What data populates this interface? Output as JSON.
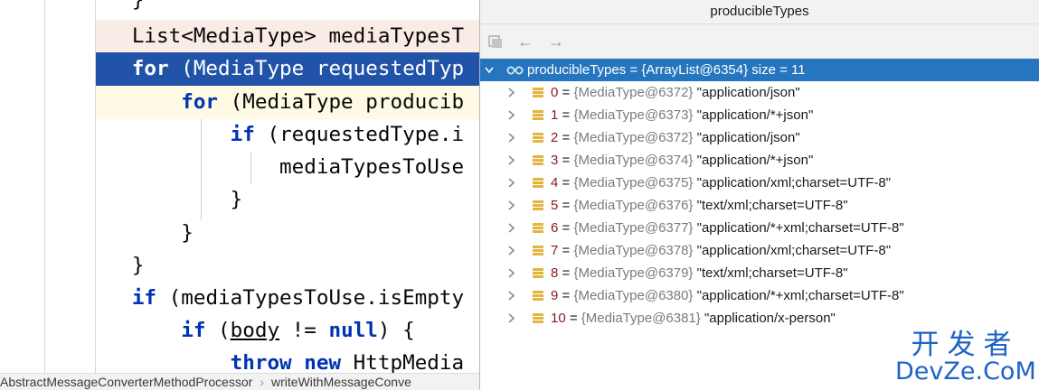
{
  "editor": {
    "lines": [
      {
        "indent": "   ",
        "tokens": [
          {
            "t": "}",
            "kw": false
          }
        ]
      },
      {
        "indent": "   ",
        "tokens": [
          {
            "t": "List<MediaType> mediaTypesT",
            "kw": false
          }
        ]
      },
      {
        "indent": "   ",
        "tokens": [
          {
            "t": "for",
            "kw": true
          },
          {
            "t": " (MediaType requestedTyp",
            "kw": false
          }
        ]
      },
      {
        "indent": "       ",
        "tokens": [
          {
            "t": "for",
            "kw": true
          },
          {
            "t": " (MediaType producib",
            "kw": false
          }
        ]
      },
      {
        "indent": "           ",
        "tokens": [
          {
            "t": "if",
            "kw": true
          },
          {
            "t": " (requestedType.i",
            "kw": false
          }
        ]
      },
      {
        "indent": "               ",
        "tokens": [
          {
            "t": "mediaTypesToUse",
            "kw": false
          }
        ]
      },
      {
        "indent": "           ",
        "tokens": [
          {
            "t": "}",
            "kw": false
          }
        ]
      },
      {
        "indent": "       ",
        "tokens": [
          {
            "t": "}",
            "kw": false
          }
        ]
      },
      {
        "indent": "   ",
        "tokens": [
          {
            "t": "}",
            "kw": false
          }
        ]
      },
      {
        "indent": "   ",
        "tokens": [
          {
            "t": "if",
            "kw": true
          },
          {
            "t": " (mediaTypesToUse.isEmpty",
            "kw": false
          }
        ]
      },
      {
        "indent": "       ",
        "tokens": [
          {
            "t": "if",
            "kw": true
          },
          {
            "t": " (",
            "kw": false
          },
          {
            "t": "body",
            "kw": false,
            "u": true
          },
          {
            "t": " != ",
            "kw": false
          },
          {
            "t": "null",
            "kw": true
          },
          {
            "t": ") {",
            "kw": false
          }
        ]
      },
      {
        "indent": "           ",
        "tokens": [
          {
            "t": "throw",
            "kw": true
          },
          {
            "t": " ",
            "kw": false
          },
          {
            "t": "new",
            "kw": true
          },
          {
            "t": " HttpMedia",
            "kw": false
          }
        ]
      }
    ]
  },
  "breadcrumb": {
    "items": [
      "AbstractMessageConverterMethodProcessor",
      "writeWithMessageConve"
    ],
    "separator": "›"
  },
  "popup": {
    "title": "producibleTypes",
    "toolbar": {
      "back_icon": "←",
      "forward_icon": "→"
    },
    "root": {
      "text": "producibleTypes = {ArrayList@6354}  size = 11"
    },
    "items": [
      {
        "index": "0",
        "ref": "{MediaType@6372}",
        "value": "\"application/json\""
      },
      {
        "index": "1",
        "ref": "{MediaType@6373}",
        "value": "\"application/*+json\""
      },
      {
        "index": "2",
        "ref": "{MediaType@6372}",
        "value": "\"application/json\""
      },
      {
        "index": "3",
        "ref": "{MediaType@6374}",
        "value": "\"application/*+json\""
      },
      {
        "index": "4",
        "ref": "{MediaType@6375}",
        "value": "\"application/xml;charset=UTF-8\""
      },
      {
        "index": "5",
        "ref": "{MediaType@6376}",
        "value": "\"text/xml;charset=UTF-8\""
      },
      {
        "index": "6",
        "ref": "{MediaType@6377}",
        "value": "\"application/*+xml;charset=UTF-8\""
      },
      {
        "index": "7",
        "ref": "{MediaType@6378}",
        "value": "\"application/xml;charset=UTF-8\""
      },
      {
        "index": "8",
        "ref": "{MediaType@6379}",
        "value": "\"text/xml;charset=UTF-8\""
      },
      {
        "index": "9",
        "ref": "{MediaType@6380}",
        "value": "\"application/*+xml;charset=UTF-8\""
      },
      {
        "index": "10",
        "ref": "{MediaType@6381}",
        "value": "\"application/x-person\""
      }
    ]
  },
  "watermark": {
    "cn": "开发者",
    "en": "DevZe.CoM"
  }
}
